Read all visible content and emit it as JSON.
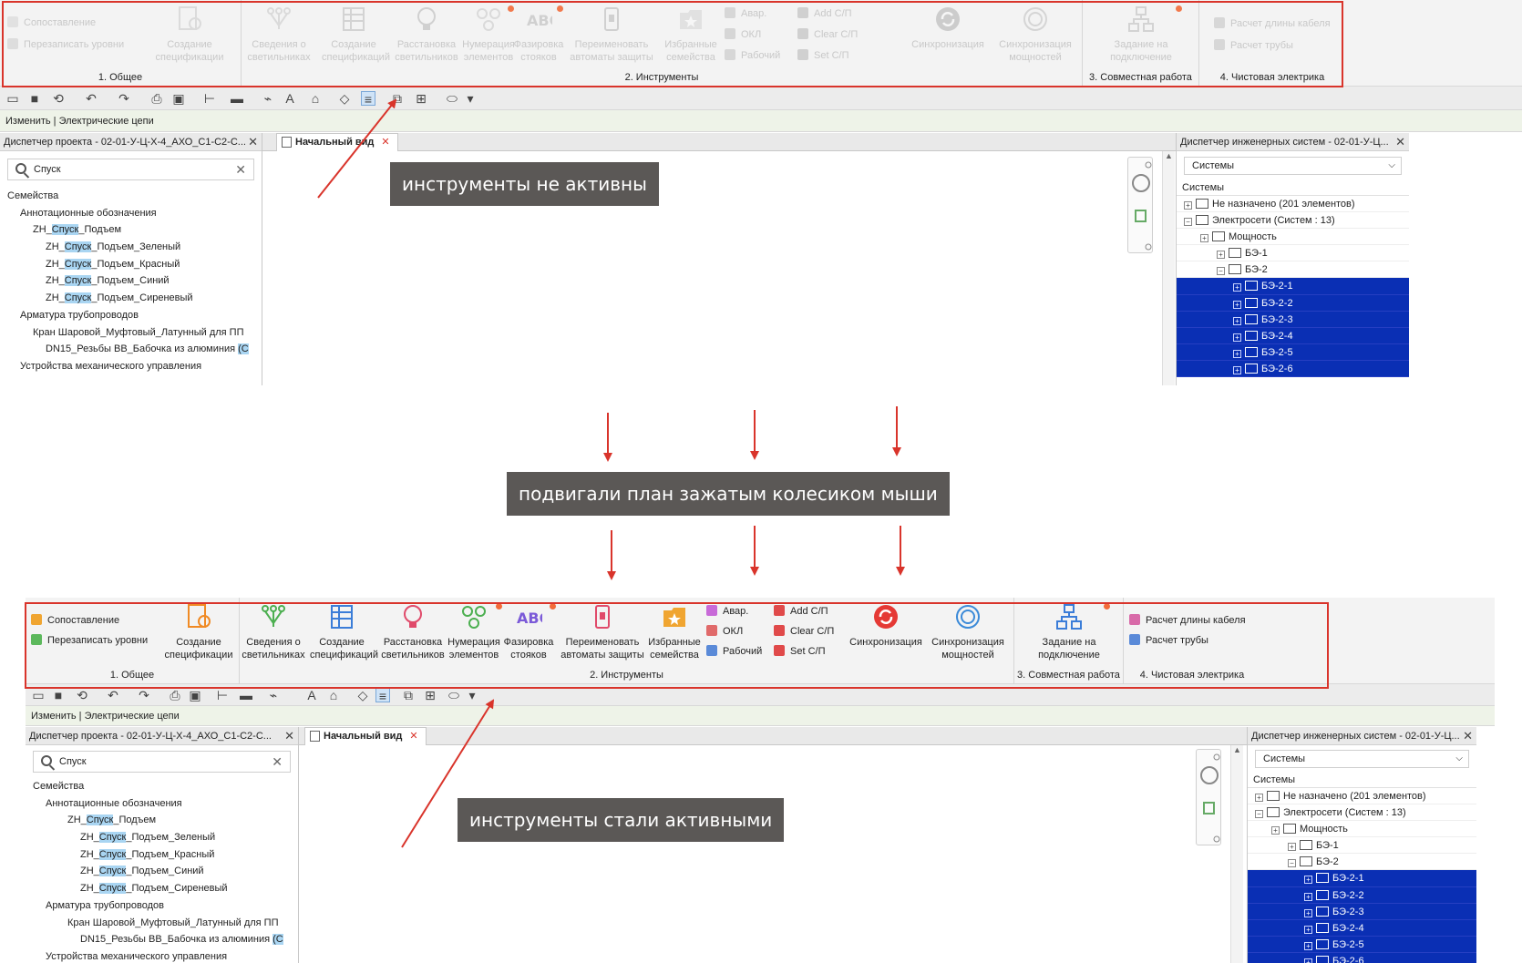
{
  "ribbon": {
    "general": {
      "match_label": "Сопоставление",
      "overwrite_label": "Перезаписать уровни",
      "create_spec_label": "Создание спецификации",
      "title": "1. Общее"
    },
    "tools": {
      "lights_info_label": "Сведения о светильниках",
      "create_spec_label": "Создание спецификаций",
      "place_lights_label": "Расстановка светильников",
      "numbering_label": "Нумерация элементов",
      "phasing_label": "Фазировка стояков",
      "rename_breakers_label": "Переименовать автоматы защиты",
      "fav_families_label": "Избранные семейства",
      "avar_label": "Авар.",
      "okl_label": "ОКЛ",
      "work_label": "Рабочий",
      "add_sp_label": "Add С/П",
      "clear_sp_label": "Clear С/П",
      "set_sp_label": "Set С/П",
      "sync_label": "Синхронизация",
      "sync_power_label": "Синхронизация мощностей",
      "title": "2. Инструменты"
    },
    "collab": {
      "task_label": "Задание на подключение",
      "title": "3. Совместная работа"
    },
    "finish": {
      "cable_label": "Расчет длины кабеля",
      "pipe_label": "Расчет трубы",
      "title": "4. Чистовая электрика"
    }
  },
  "context_bar": "Изменить | Электрические цепи",
  "project_browser": {
    "title": "Диспетчер проекта - 02-01-У-Ц-Х-4_АХО_С1-С2-С...",
    "search_value": "Спуск",
    "tree": [
      {
        "prefix": "",
        "hl": "",
        "suffix": "Семейства"
      },
      {
        "prefix": "Аннотационные обозначения",
        "hl": "",
        "suffix": ""
      },
      {
        "prefix": "ZH_",
        "hl": "Спуск",
        "suffix": "_Подъем"
      },
      {
        "prefix": "ZH_",
        "hl": "Спуск",
        "suffix": "_Подъем_Зеленый"
      },
      {
        "prefix": "ZH_",
        "hl": "Спуск",
        "suffix": "_Подъем_Красный"
      },
      {
        "prefix": "ZH_",
        "hl": "Спуск",
        "suffix": "_Подъем_Синий"
      },
      {
        "prefix": "ZH_",
        "hl": "Спуск",
        "suffix": "_Подъем_Сиреневый"
      },
      {
        "prefix": "Арматура трубопроводов",
        "hl": "",
        "suffix": ""
      },
      {
        "prefix": "Кран Шаровой_Муфтовый_Латунный для ПП",
        "hl": "",
        "suffix": ""
      },
      {
        "prefix": "DN15_Резьбы ВВ_Бабочка из алюминия ",
        "hl": "(С",
        "suffix": ""
      },
      {
        "prefix": "Устройства механического управления",
        "hl": "",
        "suffix": ""
      }
    ]
  },
  "view_tab": "Начальный вид",
  "system_browser": {
    "title": "Диспетчер инженерных систем - 02-01-У-Ц...",
    "select_value": "Системы",
    "header": "Системы",
    "rows": [
      {
        "text": "Не назначено (201 элементов)",
        "sel": false
      },
      {
        "text": "Электросети (Систем : 13)",
        "sel": false
      },
      {
        "text": "Мощность",
        "sel": false
      },
      {
        "text": "БЭ-1",
        "sel": false
      },
      {
        "text": "БЭ-2",
        "sel": false
      },
      {
        "text": "БЭ-2-1",
        "sel": true
      },
      {
        "text": "БЭ-2-2",
        "sel": true
      },
      {
        "text": "БЭ-2-3",
        "sel": true
      },
      {
        "text": "БЭ-2-4",
        "sel": true
      },
      {
        "text": "БЭ-2-5",
        "sel": true
      },
      {
        "text": "БЭ-2-6",
        "sel": true
      }
    ]
  },
  "annotations": {
    "inactive": "инструменты не активны",
    "pan": "подвигали план зажатым колесиком мыши",
    "active": "инструменты стали активными"
  },
  "colors": {
    "annotation_frame": "#d9342b",
    "callout_bg": "#5b5856",
    "selection": "#0a2fb4",
    "search_highlight": "#a9d5f2"
  }
}
